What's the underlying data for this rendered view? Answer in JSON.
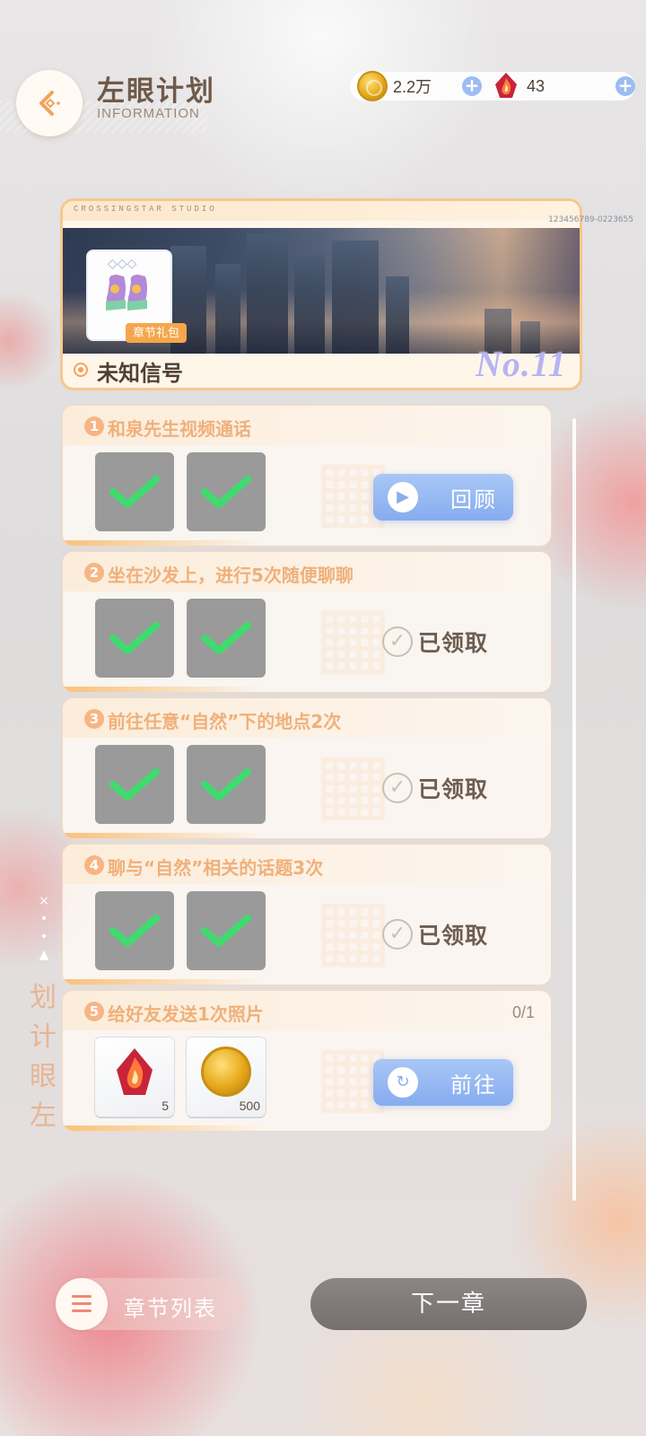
{
  "header": {
    "title": "左眼计划",
    "subtitle": "INFORMATION",
    "back_icon": "back-arrow-icon"
  },
  "currency": {
    "coins": "2.2万",
    "gems": "43"
  },
  "banner": {
    "studio": "CROSSINGSTAR STUDIO",
    "code": "123456789-0223655",
    "item_label": "章节礼包",
    "title": "未知信号",
    "number": "No.11"
  },
  "tasks": [
    {
      "num": "1",
      "title": "和泉先生视频通话",
      "state": "claimed",
      "action_label": "回顾"
    },
    {
      "num": "2",
      "title": "坐在沙发上，进行5次随便聊聊",
      "state": "claimed",
      "action_label": "已领取"
    },
    {
      "num": "3",
      "title": "前往任意“自然”下的地点2次",
      "state": "claimed",
      "action_label": "已领取"
    },
    {
      "num": "4",
      "title": "聊与“自然”相关的话题3次",
      "state": "claimed",
      "action_label": "已领取"
    },
    {
      "num": "5",
      "title": "给好友发送1次照片",
      "progress": "0/1",
      "state": "open",
      "action_label": "前往",
      "rewards": [
        {
          "icon": "flame-gem-icon",
          "count": "5"
        },
        {
          "icon": "gold-coin-icon",
          "count": "500"
        }
      ]
    }
  ],
  "side_label": "左眼计划",
  "footer": {
    "chapter_list": "章节列表",
    "next_chapter": "下一章"
  },
  "colors": {
    "accent_orange": "#f7c27d",
    "button_blue": "#86acef",
    "title_brown": "#6f5a4a"
  }
}
